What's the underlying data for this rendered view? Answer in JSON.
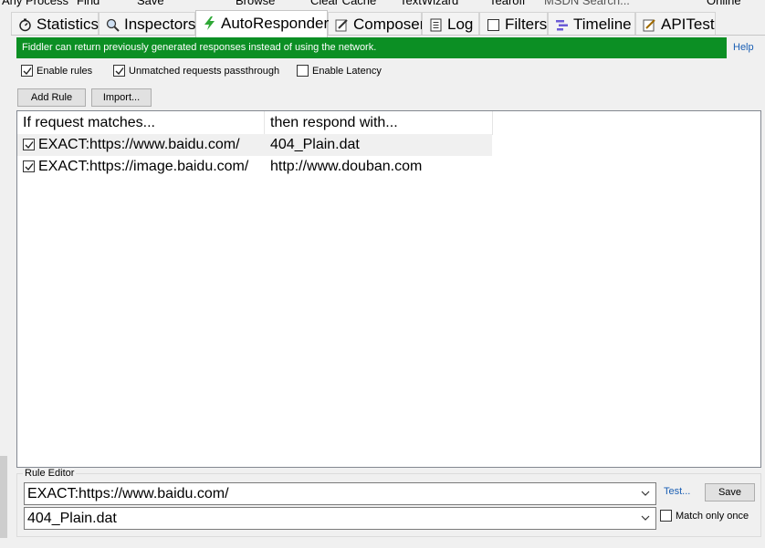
{
  "toolbar": {
    "items": [
      "Any Process",
      "Find",
      "Save",
      "Browse",
      "Clear Cache",
      "TextWizard",
      "Tearoff",
      "MSDN Search...",
      "Online"
    ]
  },
  "tabs": [
    {
      "label": "Statistics",
      "icon": "stopwatch-icon"
    },
    {
      "label": "Inspectors",
      "icon": "magnifier-icon"
    },
    {
      "label": "AutoResponder",
      "icon": "lightning-icon"
    },
    {
      "label": "Composer",
      "icon": "pencil-icon"
    },
    {
      "label": "Log",
      "icon": "log-icon"
    },
    {
      "label": "Filters",
      "icon": "checkbox-icon"
    },
    {
      "label": "Timeline",
      "icon": "timeline-icon"
    },
    {
      "label": "APITest",
      "icon": "api-test-icon"
    }
  ],
  "banner": {
    "text": "Fiddler can return previously generated responses instead of using the network.",
    "help": "Help",
    "color": "#0c8f24"
  },
  "options": {
    "enable_rules": "Enable rules",
    "unmatched_passthrough": "Unmatched requests passthrough",
    "enable_latency": "Enable Latency"
  },
  "buttons": {
    "add_rule": "Add Rule",
    "import": "Import..."
  },
  "rules_table": {
    "columns": [
      "If request matches...",
      "then respond with..."
    ],
    "rows": [
      {
        "match": "EXACT:https://www.baidu.com/",
        "respond": "404_Plain.dat",
        "checked": true
      },
      {
        "match": "EXACT:https://image.baidu.com/",
        "respond": "http://www.douban.com",
        "checked": true
      }
    ]
  },
  "rule_editor": {
    "legend": "Rule Editor",
    "match_value": "EXACT:https://www.baidu.com/",
    "respond_value": "404_Plain.dat",
    "test_link": "Test...",
    "save": "Save",
    "match_only_once": "Match only once"
  }
}
